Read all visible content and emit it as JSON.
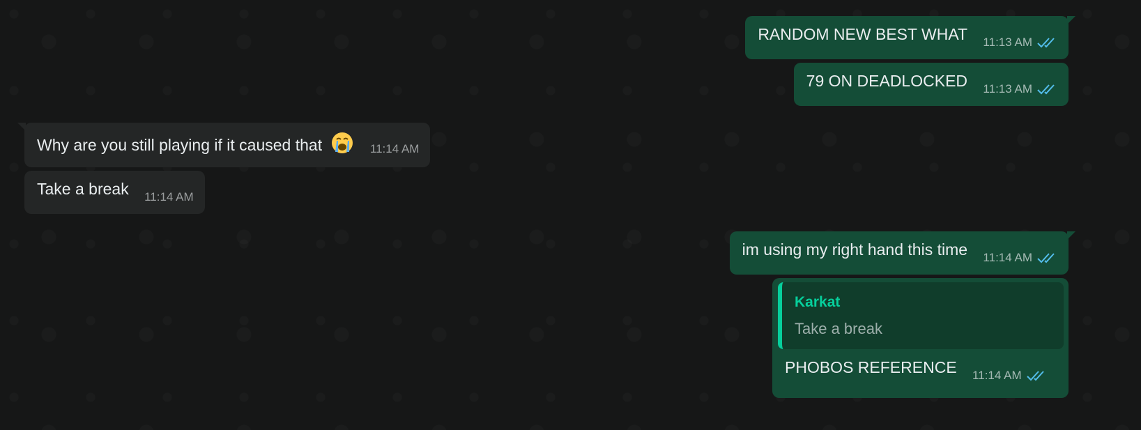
{
  "messages": [
    {
      "id": "m1",
      "direction": "outgoing",
      "text": "RANDOM NEW BEST WHAT",
      "time": "11:13 AM",
      "status": "read"
    },
    {
      "id": "m2",
      "direction": "outgoing",
      "text": "79 ON DEADLOCKED",
      "time": "11:13 AM",
      "status": "read"
    },
    {
      "id": "m3",
      "direction": "incoming",
      "text": "Why are you still playing if it caused that",
      "emoji": "loudly-crying-face",
      "time": "11:14 AM"
    },
    {
      "id": "m4",
      "direction": "incoming",
      "text": "Take a break",
      "time": "11:14 AM"
    },
    {
      "id": "m5",
      "direction": "outgoing",
      "text": "im using my right hand this time",
      "time": "11:14 AM",
      "status": "read"
    },
    {
      "id": "m6",
      "direction": "outgoing",
      "quote": {
        "author": "Karkat",
        "text": "Take a break"
      },
      "text": "PHOBOS REFERENCE",
      "time": "11:14 AM",
      "status": "read"
    }
  ],
  "colors": {
    "background": "#161717",
    "outgoing_bubble": "#144d37",
    "incoming_bubble": "#242626",
    "read_ticks": "#53bdeb",
    "quote_accent": "#06cf9c"
  }
}
